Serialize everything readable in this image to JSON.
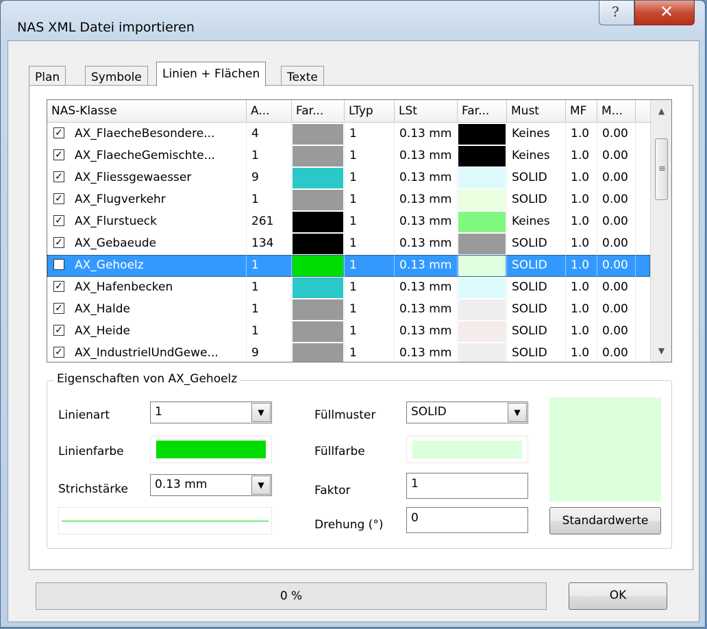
{
  "window": {
    "title": "NAS XML Datei importieren",
    "help_glyph": "?",
    "close_glyph": "✕"
  },
  "tabs": [
    {
      "label": "Plan",
      "active": false
    },
    {
      "label": "Symbole",
      "active": false
    },
    {
      "label": "Linien + Flächen",
      "active": true
    },
    {
      "label": "Texte",
      "active": false
    }
  ],
  "table": {
    "headers": [
      "NAS-Klasse",
      "A...",
      "Far...",
      "LTyp",
      "LSt",
      "Far...",
      "Must",
      "MF",
      "M..."
    ],
    "rows": [
      {
        "checked": true,
        "name": "AX_FlaecheBesondere...",
        "count": "4",
        "color1": "#9a9a9a",
        "ltyp": "1",
        "lst": "0.13 mm",
        "color2": "#000000",
        "must": "Keines",
        "mf": "1.0",
        "m": "0.00"
      },
      {
        "checked": true,
        "name": "AX_FlaecheGemischte...",
        "count": "1",
        "color1": "#9a9a9a",
        "ltyp": "1",
        "lst": "0.13 mm",
        "color2": "#000000",
        "must": "Keines",
        "mf": "1.0",
        "m": "0.00"
      },
      {
        "checked": true,
        "name": "AX_Fliessgewaesser",
        "count": "9",
        "color1": "#2ac8c8",
        "ltyp": "1",
        "lst": "0.13 mm",
        "color2": "#dcfafc",
        "must": "SOLID",
        "mf": "1.0",
        "m": "0.00"
      },
      {
        "checked": true,
        "name": "AX_Flugverkehr",
        "count": "1",
        "color1": "#9a9a9a",
        "ltyp": "1",
        "lst": "0.13 mm",
        "color2": "#eaffe0",
        "must": "SOLID",
        "mf": "1.0",
        "m": "0.00"
      },
      {
        "checked": true,
        "name": "AX_Flurstueck",
        "count": "261",
        "color1": "#000000",
        "ltyp": "1",
        "lst": "0.13 mm",
        "color2": "#80f880",
        "must": "Keines",
        "mf": "1.0",
        "m": "0.00"
      },
      {
        "checked": true,
        "name": "AX_Gebaeude",
        "count": "134",
        "color1": "#000000",
        "ltyp": "1",
        "lst": "0.13 mm",
        "color2": "#9a9a9a",
        "must": "SOLID",
        "mf": "1.0",
        "m": "0.00"
      },
      {
        "checked": true,
        "name": "AX_Gehoelz",
        "count": "1",
        "color1": "#00dd00",
        "ltyp": "1",
        "lst": "0.13 mm",
        "color2": "#e0ffe0",
        "must": "SOLID",
        "mf": "1.0",
        "m": "0.00",
        "selected": true
      },
      {
        "checked": true,
        "name": "AX_Hafenbecken",
        "count": "1",
        "color1": "#2ac8c8",
        "ltyp": "1",
        "lst": "0.13 mm",
        "color2": "#dcfafc",
        "must": "SOLID",
        "mf": "1.0",
        "m": "0.00"
      },
      {
        "checked": true,
        "name": "AX_Halde",
        "count": "1",
        "color1": "#9a9a9a",
        "ltyp": "1",
        "lst": "0.13 mm",
        "color2": "#eeeeee",
        "must": "SOLID",
        "mf": "1.0",
        "m": "0.00"
      },
      {
        "checked": true,
        "name": "AX_Heide",
        "count": "1",
        "color1": "#9a9a9a",
        "ltyp": "1",
        "lst": "0.13 mm",
        "color2": "#f4ecea",
        "must": "SOLID",
        "mf": "1.0",
        "m": "0.00"
      },
      {
        "checked": true,
        "name": "AX_IndustrielUndGewe...",
        "count": "9",
        "color1": "#9a9a9a",
        "ltyp": "1",
        "lst": "0.13 mm",
        "color2": "#eeeeee",
        "must": "SOLID",
        "mf": "1.0",
        "m": "0.00"
      }
    ]
  },
  "properties": {
    "title": "Eigenschaften von AX_Gehoelz",
    "linienart_label": "Linienart",
    "linienart_value": "1",
    "linienfarbe_label": "Linienfarbe",
    "linienfarbe_color": "#00dd00",
    "strichstaerke_label": "Strichstärke",
    "strichstaerke_value": "0.13 mm",
    "fuellmuster_label": "Füllmuster",
    "fuellmuster_value": "SOLID",
    "fuellfarbe_label": "Füllfarbe",
    "fuellfarbe_color": "#dcffdc",
    "faktor_label": "Faktor",
    "faktor_value": "1",
    "drehung_label": "Drehung (°)",
    "drehung_value": "0",
    "standardwerte_label": "Standardwerte",
    "preview_color": "#dcffdc",
    "line_preview_color": "#00dd00"
  },
  "footer": {
    "progress_text": "0 %",
    "progress_value": 0,
    "ok_label": "OK"
  }
}
